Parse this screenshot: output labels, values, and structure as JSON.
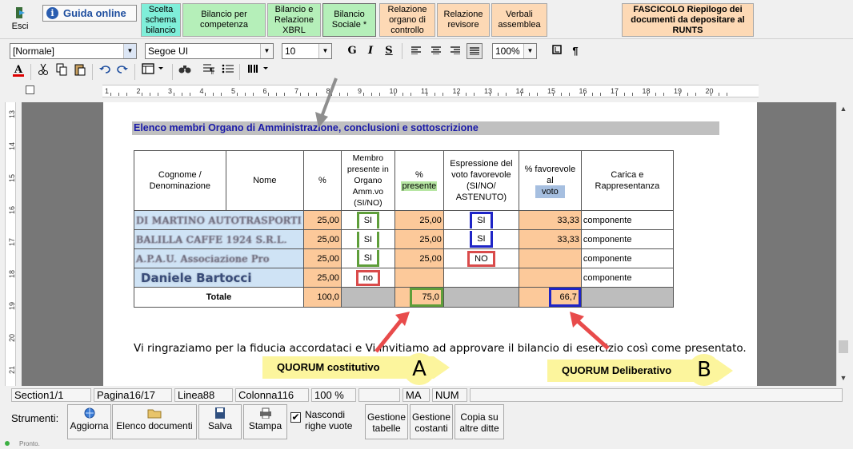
{
  "toolbar": {
    "exit_label": "Esci",
    "help_label": "Guida online",
    "tabs": [
      "Scelta schema bilancio",
      "Bilancio per competenza",
      "Bilancio e Relazione XBRL",
      "Bilancio Sociale *",
      "Relazione organo di controllo",
      "Relazione revisore",
      "Verbali assemblea"
    ],
    "fascicolo": "FASCICOLO Riepilogo dei documenti da depositare al RUNTS"
  },
  "format": {
    "style_value": "[Normale]",
    "font_value": "Segoe UI",
    "size_value": "10",
    "bold": "G",
    "italic": "I",
    "underline": "S",
    "zoom_value": "100%",
    "pilcrow": "¶"
  },
  "ruler": {
    "numbers": [
      "1",
      "2",
      "3",
      "4",
      "5",
      "6",
      "7",
      "8",
      "9",
      "10",
      "11",
      "12",
      "13",
      "14",
      "15",
      "16",
      "17",
      "18",
      "19",
      "20"
    ],
    "vnumbers": [
      "13",
      "14",
      "15",
      "16",
      "17",
      "18",
      "19",
      "20",
      "21"
    ]
  },
  "document": {
    "section_title": "Elenco membri Organo di Amministrazione, conclusioni e sottoscrizione",
    "table": {
      "headers": {
        "cognome": "Cognome / Denominazione",
        "nome": "Nome",
        "pct": "%",
        "membro": "Membro presente in Organo Amm.vo (SI/NO)",
        "pct_presente_prefix": "%",
        "pct_presente_hl": "presente",
        "espressione": "Espressione del voto favorevole (SI/NO/ ASTENUTO)",
        "pct_favorevole": "% favorevole al",
        "pct_favorevole_hl": "voto",
        "carica": "Carica e Rappresentanza"
      },
      "rows": [
        {
          "name": "DI MARTINO AUTOTRASPORTI",
          "pct": "25,00",
          "membro": "SI",
          "pres": "25,00",
          "voto": "SI",
          "fav": "33,33",
          "carica": "componente"
        },
        {
          "name": "BALILLA CAFFE 1924 S.R.L.",
          "pct": "25,00",
          "membro": "SI",
          "pres": "25,00",
          "voto": "SI",
          "fav": "33,33",
          "carica": "componente"
        },
        {
          "name": "A.P.A.U. Associazione Pro",
          "pct": "25,00",
          "membro": "SI",
          "pres": "25,00",
          "voto": "NO",
          "fav": "",
          "carica": "componente"
        },
        {
          "name": "Daniele Bartocci",
          "pct": "25,00",
          "membro": "no",
          "pres": "",
          "voto": "",
          "fav": "",
          "carica": "componente"
        }
      ],
      "total": {
        "label": "Totale",
        "pct": "100,0",
        "pres": "75,0",
        "fav": "66,7"
      }
    },
    "thanks_text": "Vi ringraziamo per la fiducia accordataci e Vi invitiamo ad approvare il bilancio di esercizio così come presentato.",
    "callouts": {
      "a_label": "QUORUM costitutivo",
      "a_letter": "A",
      "b_label": "QUORUM Deliberativo",
      "b_letter": "B"
    }
  },
  "status": {
    "section": "Section1/1",
    "page": "Pagina16/17",
    "line": "Linea88",
    "column": "Colonna116",
    "zoom": "100 %",
    "ma": "MA",
    "num": "NUM"
  },
  "tools": {
    "label": "Strumenti:",
    "aggiorna": "Aggiorna",
    "elenco": "Elenco documenti",
    "salva": "Salva",
    "stampa": "Stampa",
    "nascondi": "Nascondi righe vuote",
    "gestione_tabelle": "Gestione tabelle",
    "gestione_costanti": "Gestione costanti",
    "copia": "Copia su altre ditte"
  },
  "footer": {
    "status_text": "Pronto."
  },
  "colors": {
    "green_tab": "#b5efb9",
    "cyan_tab": "#7feed9",
    "peach": "#fcc99a",
    "callout": "#fcf59d",
    "arrow_red": "#e84b4b"
  }
}
